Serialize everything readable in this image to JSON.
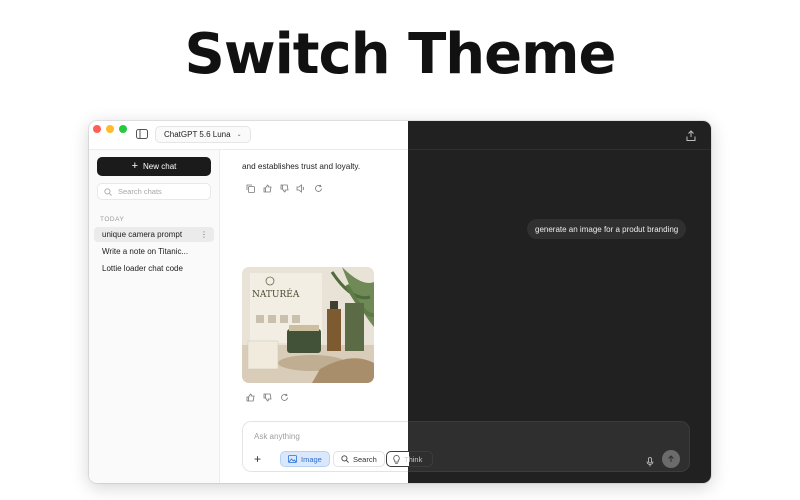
{
  "headline": "Switch Theme",
  "window": {
    "model": "ChatGPT 5.6 Luna"
  },
  "sidebar": {
    "new_chat": "New chat",
    "search_placeholder": "Search chats",
    "section_label": "TODAY",
    "items": [
      {
        "label": "unique camera prompt",
        "active": true
      },
      {
        "label": "Write a note on Titanic..."
      },
      {
        "label": "Lottie loader chat code"
      }
    ]
  },
  "conversation": {
    "assistant_text": "and establishes trust and loyalty.",
    "user_message": "generate an image for a produt branding",
    "image_brand": "NATURÉA"
  },
  "composer": {
    "placeholder": "Ask anything",
    "image_label": "Image",
    "search_label": "Search",
    "think_label": "Think"
  },
  "colors": {
    "dark_bg": "#212121",
    "accent_blue": "#2b6dd2"
  }
}
